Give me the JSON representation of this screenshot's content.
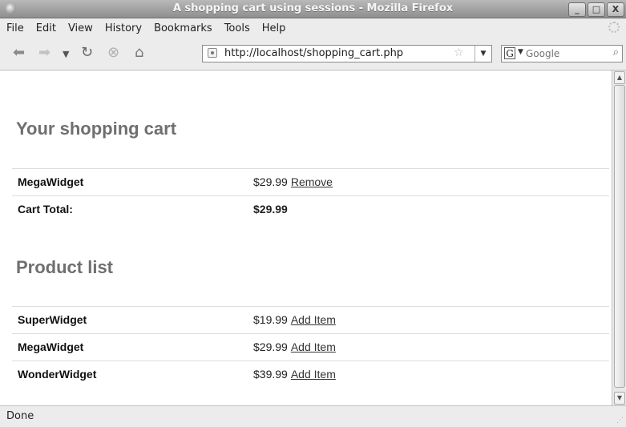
{
  "window": {
    "title": "A shopping cart using sessions - Mozilla Firefox",
    "buttons": {
      "minimize": "_",
      "maximize": "□",
      "close": "X"
    }
  },
  "menu": [
    "File",
    "Edit",
    "View",
    "History",
    "Bookmarks",
    "Tools",
    "Help"
  ],
  "nav": {
    "url": "http://localhost/shopping_cart.php",
    "search_placeholder": "Google",
    "search_engine": "G"
  },
  "cart": {
    "heading": "Your shopping cart",
    "items": [
      {
        "name": "MegaWidget",
        "price": "$29.99",
        "action": "Remove"
      }
    ],
    "total_label": "Cart Total:",
    "total_value": "$29.99"
  },
  "products": {
    "heading": "Product list",
    "items": [
      {
        "name": "SuperWidget",
        "price": "$19.99",
        "action": "Add Item"
      },
      {
        "name": "MegaWidget",
        "price": "$29.99",
        "action": "Add Item"
      },
      {
        "name": "WonderWidget",
        "price": "$39.99",
        "action": "Add Item"
      }
    ]
  },
  "status": "Done",
  "icons": {
    "back": "back-arrow-icon",
    "forward": "forward-arrow-icon",
    "reload": "reload-icon",
    "stop": "stop-icon",
    "home": "home-icon",
    "bookmark": "star-icon",
    "search": "magnifier-icon"
  }
}
